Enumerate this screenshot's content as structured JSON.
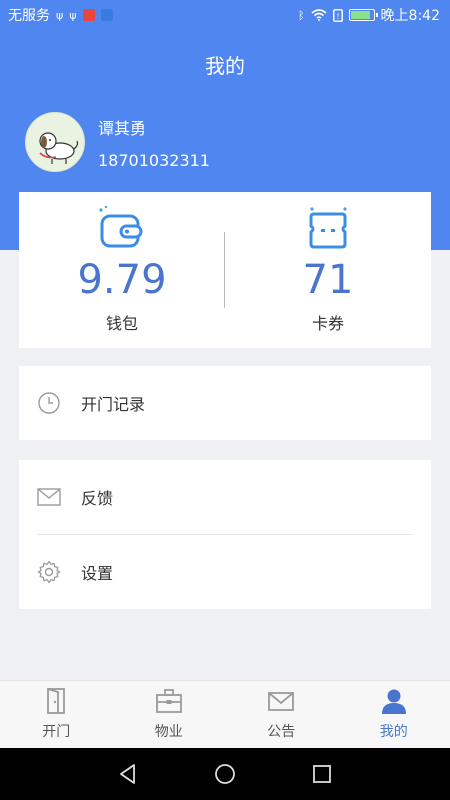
{
  "status_bar": {
    "carrier": "无服务",
    "time": "晚上8:42"
  },
  "header": {
    "title": "我的"
  },
  "user": {
    "name": "谭其勇",
    "phone": "18701032311"
  },
  "stats": {
    "wallet": {
      "value": "9.79",
      "label": "钱包",
      "icon": "wallet-icon"
    },
    "coupons": {
      "value": "71",
      "label": "卡券",
      "icon": "coupon-icon"
    }
  },
  "menu": {
    "door_log": {
      "label": "开门记录",
      "icon": "clock-icon"
    },
    "feedback": {
      "label": "反馈",
      "icon": "mail-icon"
    },
    "settings": {
      "label": "设置",
      "icon": "gear-icon"
    }
  },
  "tabbar": {
    "tabs": [
      {
        "label": "开门",
        "icon": "door-icon",
        "active": false
      },
      {
        "label": "物业",
        "icon": "briefcase-icon",
        "active": false
      },
      {
        "label": "公告",
        "icon": "envelope-icon",
        "active": false
      },
      {
        "label": "我的",
        "icon": "person-icon",
        "active": true
      }
    ]
  },
  "colors": {
    "primary": "#4f86f0",
    "accent_text": "#4a75cf",
    "background": "#eef0f4"
  }
}
